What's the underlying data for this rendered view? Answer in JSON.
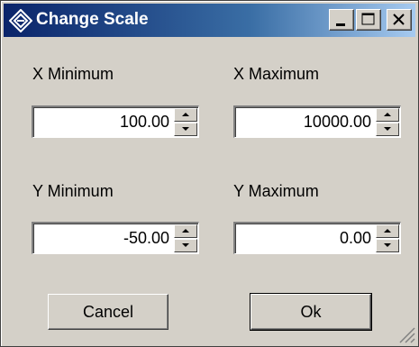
{
  "window": {
    "title": "Change Scale",
    "icon": "rohde-schwarz-diamond-icon"
  },
  "title_buttons": {
    "minimize": "minimize-icon",
    "maximize": "maximize-icon",
    "close": "close-icon"
  },
  "fields": {
    "x_min": {
      "label": "X Minimum",
      "value": "100.00"
    },
    "x_max": {
      "label": "X Maximum",
      "value": "10000.00"
    },
    "y_min": {
      "label": "Y Minimum",
      "value": "-50.00"
    },
    "y_max": {
      "label": "Y Maximum",
      "value": "0.00"
    }
  },
  "buttons": {
    "cancel": "Cancel",
    "ok": "Ok"
  }
}
